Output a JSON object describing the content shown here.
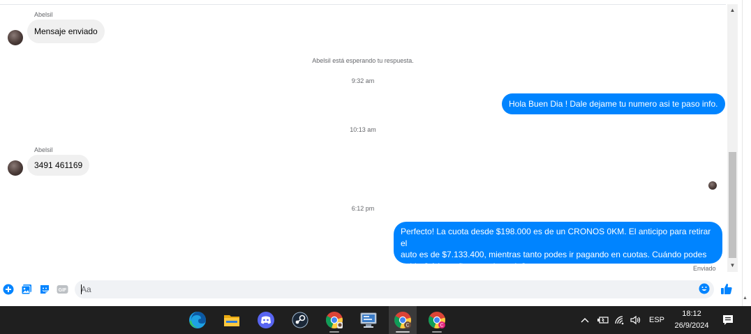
{
  "conversation": {
    "sender_name": "Abelsil",
    "messages": [
      {
        "from": "them",
        "text": "Mensaje enviado"
      },
      {
        "from": "them",
        "text": "3491 461169"
      }
    ],
    "outgoing": [
      {
        "text": "Hola Buen Dia ! Dale dejame tu numero asi te paso info."
      },
      {
        "line1": "Perfecto! La cuota desde $198.000 es de un CRONOS 0KM. El anticipo para retirar el",
        "line2": "auto es de $7.133.400, mientras tanto podes ir pagando en cuotas. Cuándo podes",
        "line3": "hablar? A la mañana o a la tarde?"
      }
    ],
    "waiting_notice": "Abelsil está esperando tu respuesta.",
    "timestamps": [
      "9:32 am",
      "10:13 am",
      "6:12 pm"
    ],
    "status": "Enviado"
  },
  "composer": {
    "placeholder": "Aa"
  },
  "taskbar": {
    "apps": [
      "edge-icon",
      "file-explorer-icon",
      "discord-icon",
      "steam-icon",
      "chrome-icon",
      "control-panel-icon",
      "chrome-profile-icon",
      "chrome-profile-icon"
    ],
    "language": "ESP",
    "time": "18:12",
    "date": "26/9/2024"
  },
  "colors": {
    "outgoing_bubble": "#0084ff",
    "incoming_bubble": "#f0f0f0",
    "accent": "#0084ff",
    "taskbar": "#1f1f1f"
  }
}
